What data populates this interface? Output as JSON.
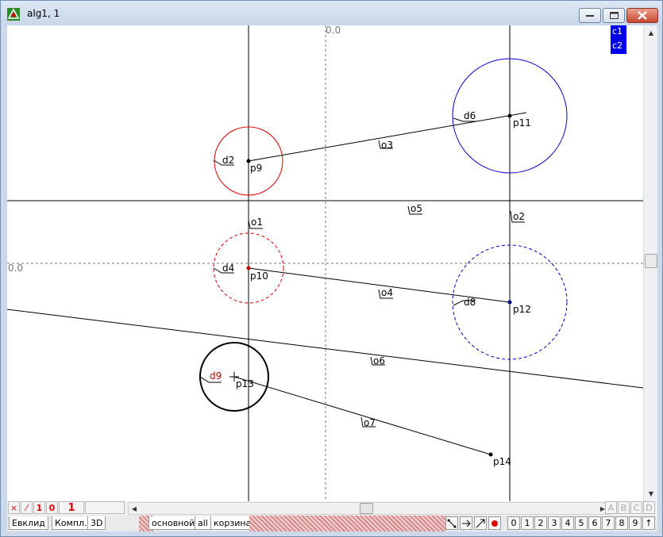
{
  "window": {
    "title": "alg1, 1"
  },
  "canvas": {
    "origin_label_top": "0.0",
    "origin_label_left": "0.0",
    "legend": [
      "c1",
      "c2"
    ],
    "labels": {
      "d2": "d2",
      "p9": "p9",
      "d6": "d6",
      "p11": "p11",
      "o3": "o3",
      "o5": "o5",
      "o1": "o1",
      "o2": "o2",
      "d4": "d4",
      "p10": "p10",
      "o4": "o4",
      "d8": "d8",
      "p12": "p12",
      "o6": "o6",
      "d9": "d9",
      "p13": "p13",
      "o7": "o7",
      "p14": "p14"
    }
  },
  "bottom_left_tools": [
    "×",
    "⁄",
    "1",
    "0",
    "1"
  ],
  "tabs_left": [
    "Евклид",
    "Компл.",
    "3D"
  ],
  "tabs_right": [
    "основной",
    "all",
    "корзина"
  ],
  "letter_buttons": [
    "A",
    "B",
    "C",
    "D"
  ],
  "digit_buttons": [
    "0",
    "1",
    "2",
    "3",
    "4",
    "5",
    "6",
    "7",
    "8",
    "9",
    "↑"
  ],
  "colors": {
    "red": "#e00000",
    "blue": "#0000d0",
    "legend_bg": "#0000ee"
  }
}
